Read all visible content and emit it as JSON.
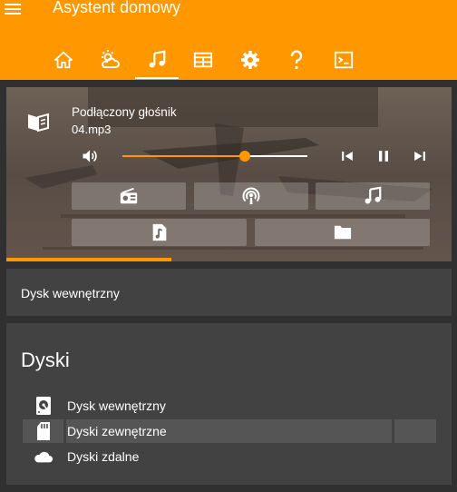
{
  "app": {
    "title": "Asystent domowy",
    "accent_color": "#ff9800",
    "icons": [
      "menu-icon"
    ]
  },
  "tabs": {
    "items": [
      {
        "icon": "home-icon"
      },
      {
        "icon": "weather-icon"
      },
      {
        "icon": "music-note-icon",
        "selected": true
      },
      {
        "icon": "calendar-icon"
      },
      {
        "icon": "settings-icon"
      },
      {
        "icon": "help-icon"
      },
      {
        "icon": "console-icon"
      }
    ]
  },
  "player": {
    "speaker_name": "Podłączony głośnik",
    "track_name": "04.mp3",
    "volume_percent": 66,
    "playback_progress_percent": 37,
    "state": "playing",
    "source_buttons": [
      {
        "icon": "radio-icon"
      },
      {
        "icon": "podcast-icon"
      },
      {
        "icon": "music-note-icon"
      },
      {
        "icon": "music-file-icon"
      },
      {
        "icon": "folder-icon"
      }
    ],
    "controls": [
      "skip-previous-icon",
      "pause-icon",
      "skip-next-icon"
    ]
  },
  "current_source": {
    "label": "Dysk wewnętrzny"
  },
  "disks": {
    "title": "Dyski",
    "items": [
      {
        "label": "Dysk wewnętrzny",
        "icon": "hard-disk-icon",
        "selected": false
      },
      {
        "label": "Dyski zewnętrzne",
        "icon": "sd-card-icon",
        "selected": true
      },
      {
        "label": "Dyski zdalne",
        "icon": "cloud-icon",
        "selected": false
      }
    ]
  }
}
